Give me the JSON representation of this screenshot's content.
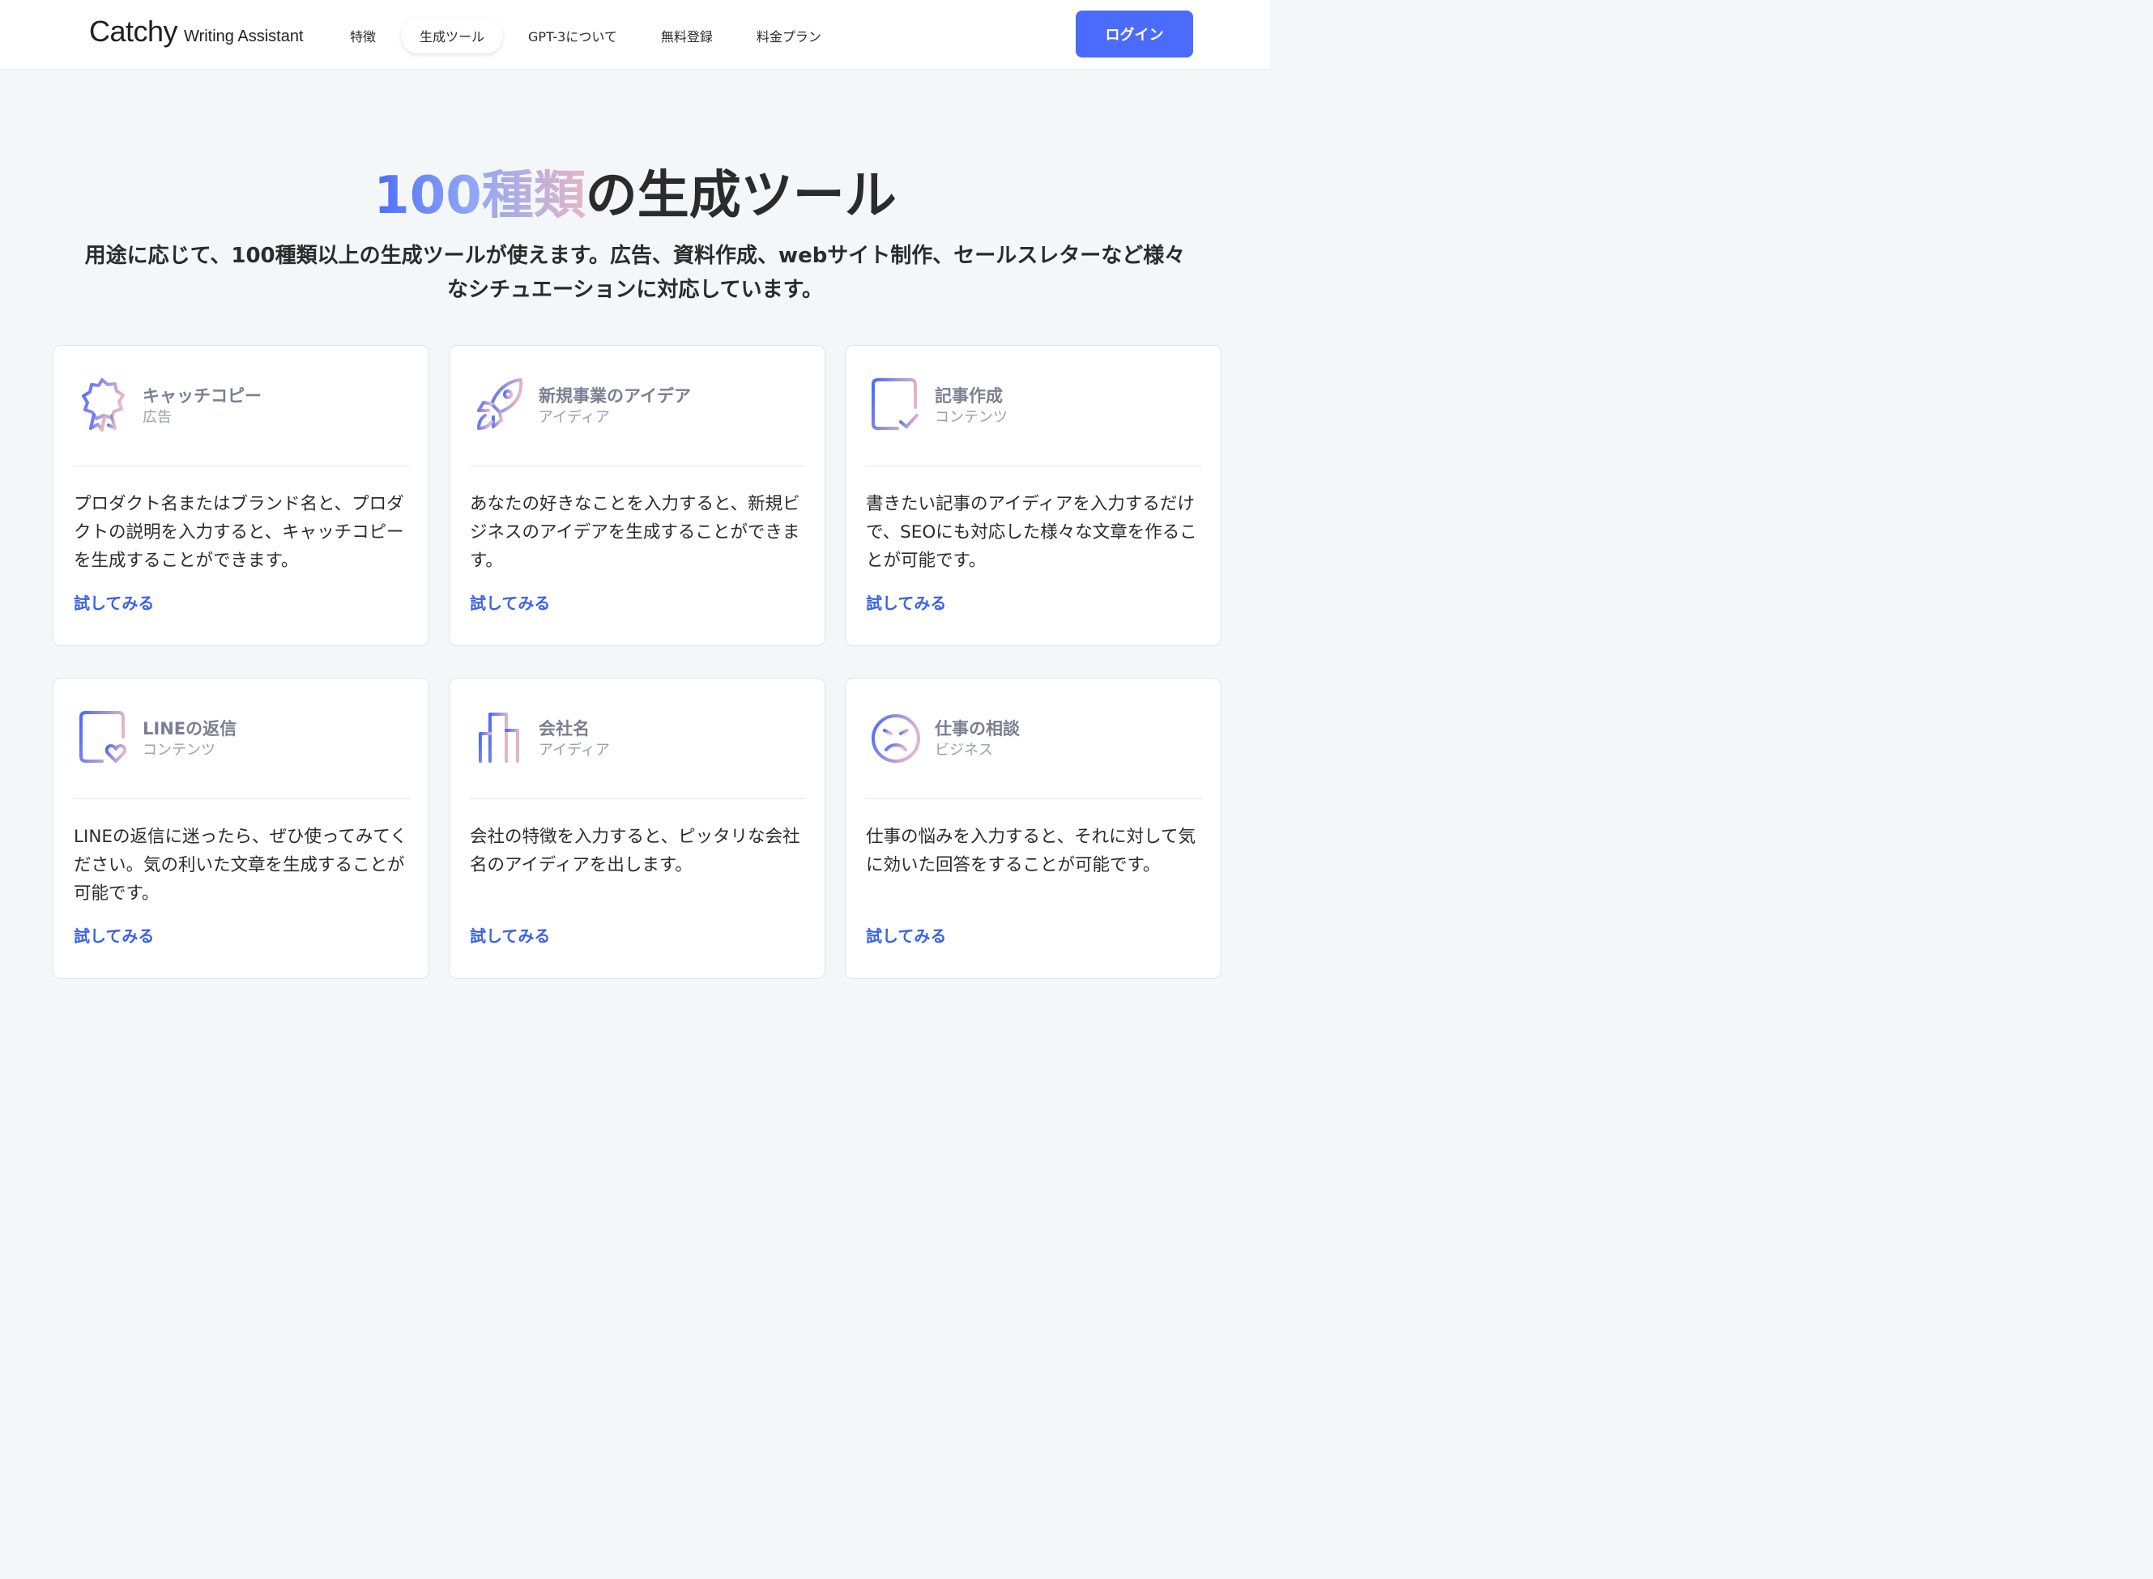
{
  "header": {
    "logo_main": "Catchy",
    "logo_sub": "Writing Assistant",
    "nav": [
      "特徴",
      "生成ツール",
      "GPT-3について",
      "無料登録",
      "料金プラン"
    ],
    "login_label": "ログイン"
  },
  "hero": {
    "title_highlight": "100種類",
    "title_rest": "の生成ツール",
    "subtitle_line1": "用途に応じて、100種類以上の生成ツールが使えます。広告、資料作成、webサイト制作、セールスレターなど様々",
    "subtitle_line2": "なシチュエーションに対応しています。"
  },
  "cards": [
    {
      "title": "キャッチコピー",
      "category": "広告",
      "icon": "award-ribbon-icon",
      "description": "プロダクト名またはブランド名と、プロダクトの説明を入力すると、キャッチコピーを生成することができます。",
      "link": "試してみる"
    },
    {
      "title": "新規事業のアイデア",
      "category": "アイディア",
      "icon": "rocket-icon",
      "description": "あなたの好きなことを入力すると、新規ビジネスのアイデアを生成することができます。",
      "link": "試してみる"
    },
    {
      "title": "記事作成",
      "category": "コンテンツ",
      "icon": "document-check-icon",
      "description": "書きたい記事のアイディアを入力するだけで、SEOにも対応した様々な文章を作ることが可能です。",
      "link": "試してみる"
    },
    {
      "title": "LINEの返信",
      "category": "コンテンツ",
      "icon": "document-heart-icon",
      "description": "LINEの返信に迷ったら、ぜひ使ってみてください。気の利いた文章を生成することが可能です。",
      "link": "試してみる"
    },
    {
      "title": "会社名",
      "category": "アイディア",
      "icon": "building-icon",
      "description": "会社の特徴を入力すると、ピッタリな会社名のアイディアを出します。",
      "link": "試してみる"
    },
    {
      "title": "仕事の相談",
      "category": "ビジネス",
      "icon": "sad-face-icon",
      "description": "仕事の悩みを入力すると、それに対して気に効いた回答をすることが可能です。",
      "link": "試してみる"
    }
  ],
  "colors": {
    "accent": "#4b6bfb",
    "link": "#3a62e8",
    "icon_gradient_start": "#4b6bfb",
    "icon_gradient_end": "#e3b6c6",
    "background": "#f4f7fa"
  }
}
